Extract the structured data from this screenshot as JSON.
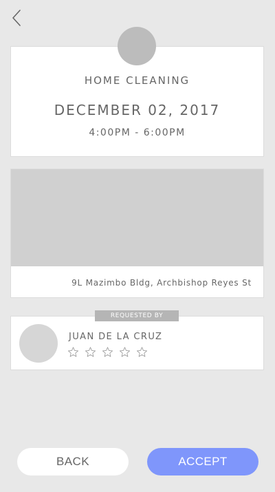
{
  "nav": {
    "back_icon": "chevron-left-icon"
  },
  "service": {
    "title": "HOME CLEANING",
    "date": "DECEMBER 02, 2017",
    "time": "4:00PM - 6:00PM"
  },
  "location": {
    "address": "9L Mazimbo Bldg, Archbishop Reyes St"
  },
  "requester": {
    "badge": "REQUESTED BY",
    "name": "JUAN DE LA CRUZ",
    "rating": 0,
    "rating_max": 5
  },
  "actions": {
    "back_label": "BACK",
    "accept_label": "ACCEPT"
  },
  "colors": {
    "accent": "#7f96fb",
    "background": "#e8e8e8",
    "badge": "#b5b5b5"
  }
}
